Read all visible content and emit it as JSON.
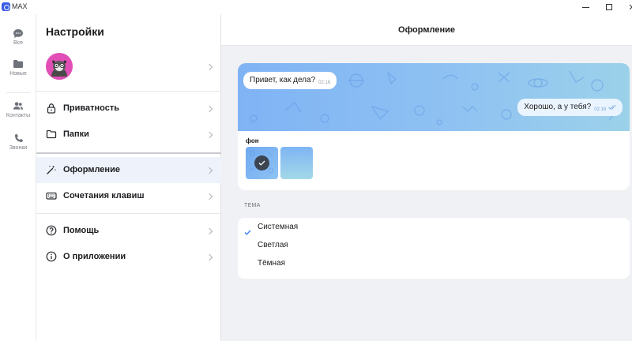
{
  "window": {
    "app_name": "MAX",
    "controls": {
      "minimize": "minimize",
      "maximize": "maximize",
      "close": "✕"
    }
  },
  "rail": {
    "items": [
      {
        "label": "Все",
        "icon": "chat-icon"
      },
      {
        "label": "Новые",
        "icon": "folder-icon"
      },
      {
        "label": "Контакты",
        "icon": "contacts-icon"
      },
      {
        "label": "Звонки",
        "icon": "phone-icon"
      }
    ]
  },
  "settings": {
    "title": "Настройки",
    "profile": {
      "avatar": "cat-avatar"
    },
    "menu": [
      {
        "label": "Приватность",
        "icon": "lock-icon"
      },
      {
        "label": "Папки",
        "icon": "folder-icon"
      },
      {
        "label": "Оформление",
        "icon": "magic-wand-icon",
        "active": true
      },
      {
        "label": "Сочетания клавиш",
        "icon": "keyboard-icon"
      },
      {
        "label": "Помощь",
        "icon": "help-icon"
      },
      {
        "label": "О приложении",
        "icon": "info-icon"
      }
    ]
  },
  "main": {
    "title": "Оформление",
    "preview": {
      "incoming": {
        "text": "Привет, как дела?",
        "time": "02:16"
      },
      "outgoing": {
        "text": "Хорошо, а у тебя?",
        "time": "02:16"
      }
    },
    "background": {
      "label": "фон",
      "swatches": [
        {
          "selected": true,
          "color": "#7fb3f4"
        },
        {
          "selected": false,
          "color": "#9ccdf0"
        }
      ]
    },
    "theme": {
      "label": "ТЕМА",
      "options": [
        {
          "label": "Системная",
          "selected": true
        },
        {
          "label": "Светлая",
          "selected": false
        },
        {
          "label": "Тёмная",
          "selected": false
        }
      ]
    }
  },
  "colors": {
    "accent": "#2d7cf6",
    "active_row": "#eef3fb",
    "bg": "#f0f1f4"
  }
}
